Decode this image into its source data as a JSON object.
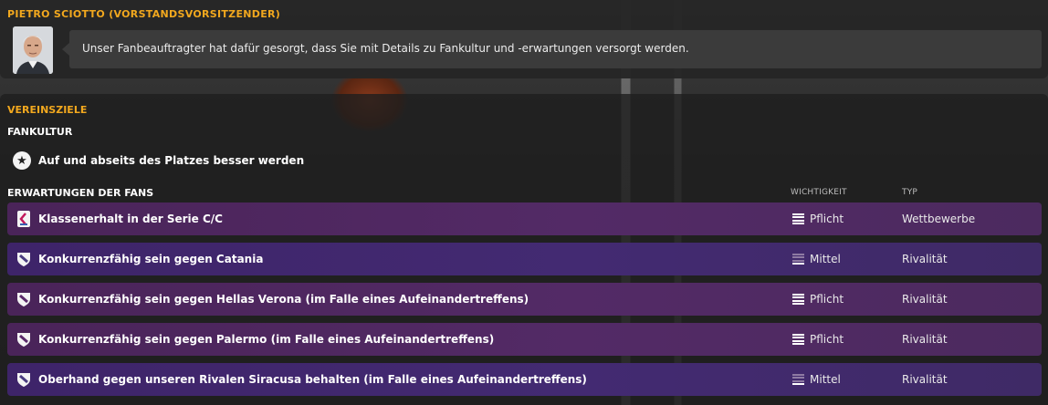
{
  "message": {
    "sender": "PIETRO SCIOTTO (VORSTANDSVORSITZENDER)",
    "text": "Unser Fanbeauftragter hat dafür gesorgt, dass Sie mit Details zu Fankultur und -erwartungen versorgt werden.",
    "avatar_icon": "chairman-portrait"
  },
  "goals": {
    "title": "VEREINSZIELE",
    "culture_title": "FANKULTUR",
    "culture_item": "Auf und abseits des Platzes besser werden",
    "culture_icon": "star-icon",
    "expectations_title": "ERWARTUNGEN DER FANS",
    "col_importance": "WICHTIGKEIT",
    "col_type": "TYP",
    "rows": [
      {
        "text": "Klassenerhalt in der Serie C/C",
        "importance": "Pflicht",
        "importance_level": "high",
        "type": "Wettbewerbe",
        "icon": "competition-logo-icon"
      },
      {
        "text": "Konkurrenzfähig sein gegen Catania",
        "importance": "Mittel",
        "importance_level": "medium",
        "type": "Rivalität",
        "icon": "club-crest-icon"
      },
      {
        "text": "Konkurrenzfähig sein gegen Hellas Verona (im Falle eines Aufeinandertreffens)",
        "importance": "Pflicht",
        "importance_level": "high",
        "type": "Rivalität",
        "icon": "club-crest-icon"
      },
      {
        "text": "Konkurrenzfähig sein gegen Palermo (im Falle eines Aufeinandertreffens)",
        "importance": "Pflicht",
        "importance_level": "high",
        "type": "Rivalität",
        "icon": "club-crest-icon"
      },
      {
        "text": "Oberhand gegen unseren Rivalen Siracusa behalten (im Falle eines Aufeinandertreffens)",
        "importance": "Mittel",
        "importance_level": "medium",
        "type": "Rivalität",
        "icon": "club-crest-icon"
      }
    ]
  },
  "colors": {
    "accent": "#f2a81e",
    "row_purple": "#532a66",
    "row_violet": "#432a72"
  }
}
